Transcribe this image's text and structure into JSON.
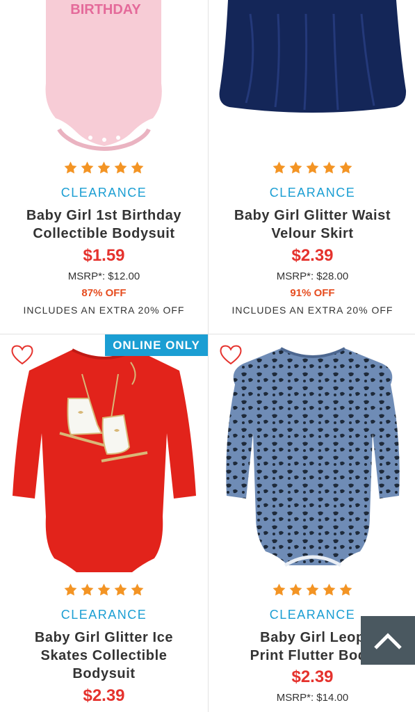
{
  "colors": {
    "accent": "#1b9ed3",
    "price": "#e5322d",
    "discount": "#e64c1f",
    "star": "#f39424",
    "scroll_top_bg": "#4a5860"
  },
  "products": [
    {
      "image": {
        "graphic_text": "BIRTHDAY"
      },
      "status": "CLEARANCE",
      "name_line1": "Baby Girl 1st Birthday",
      "name_line2": "Collectible Bodysuit",
      "price": "$1.59",
      "msrp": "MSRP*: $12.00",
      "discount": "87% OFF",
      "extra": "INCLUDES AN EXTRA 20% OFF",
      "rating_stars": 5
    },
    {
      "status": "CLEARANCE",
      "name_line1": "Baby Girl Glitter Waist",
      "name_line2": "Velour Skirt",
      "price": "$2.39",
      "msrp": "MSRP*: $28.00",
      "discount": "91% OFF",
      "extra": "INCLUDES AN EXTRA 20% OFF",
      "rating_stars": 5
    },
    {
      "badge": "ONLINE ONLY",
      "favorite_icon": "heart-outline-icon",
      "status": "CLEARANCE",
      "name_line1": "Baby Girl Glitter Ice",
      "name_line2": "Skates Collectible",
      "name_line3": "Bodysuit",
      "price": "$2.39",
      "rating_stars": 5
    },
    {
      "favorite_icon": "heart-outline-icon",
      "status": "CLEARANCE",
      "name_line1": "Baby Girl Leop",
      "name_line2": "Print Flutter Body",
      "price": "$2.39",
      "msrp": "MSRP*: $14.00",
      "rating_stars": 5
    }
  ],
  "scroll_top_icon": "chevron-up-icon"
}
